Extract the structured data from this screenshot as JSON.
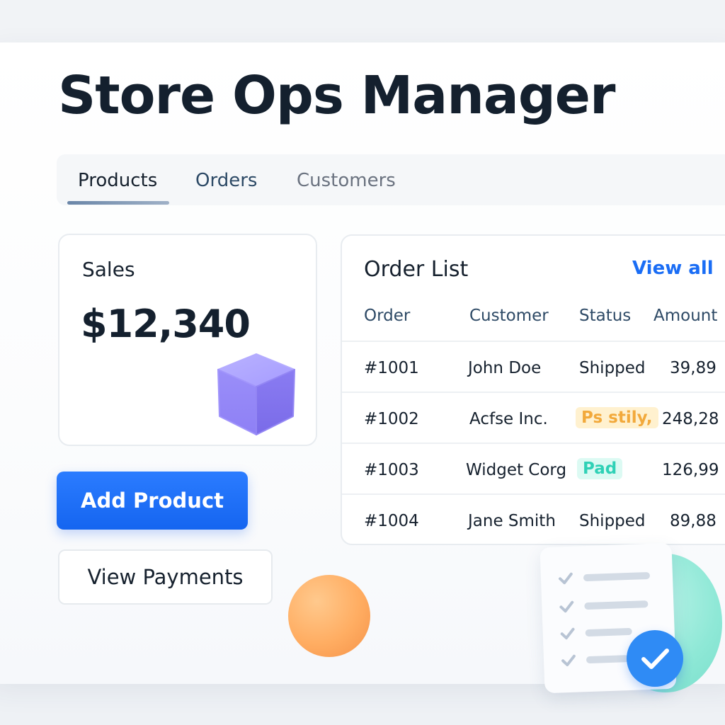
{
  "app": {
    "title": "Store Ops Manager"
  },
  "tabs": [
    {
      "label": "Products",
      "active": true
    },
    {
      "label": "Orders",
      "active": false
    },
    {
      "label": "Customers",
      "active": false
    }
  ],
  "sales_card": {
    "label": "Sales",
    "value": "$12,340",
    "icon": "cube-icon"
  },
  "actions": {
    "add_product_label": "Add Product",
    "view_payments_label": "View Payments"
  },
  "order_list": {
    "title": "Order List",
    "view_all_label": "View all",
    "columns": [
      "Order",
      "Customer",
      "Status",
      "Amount"
    ],
    "rows": [
      {
        "order": "#1001",
        "customer": "John Doe",
        "status": "Shipped",
        "amount": "39,89"
      },
      {
        "order": "#1002",
        "customer": "Acfse Inc.",
        "status": "Ps stily,",
        "amount": "248,28"
      },
      {
        "order": "#1003",
        "customer": "Widget Corg",
        "status": "Pad",
        "amount": "126,99"
      },
      {
        "order": "#1004",
        "customer": "Jane Smith",
        "status": "Shipped",
        "amount": "89,88"
      }
    ]
  },
  "colors": {
    "primary": "#1a6df5",
    "title_text": "#14202e",
    "pending_badge": "#f2a93b",
    "paid_badge": "#2fd1b6"
  },
  "decorations": {
    "icons": [
      "cube-icon",
      "orange-sphere-icon",
      "checklist-icon",
      "checkmark-icon",
      "teal-blob-icon"
    ]
  }
}
